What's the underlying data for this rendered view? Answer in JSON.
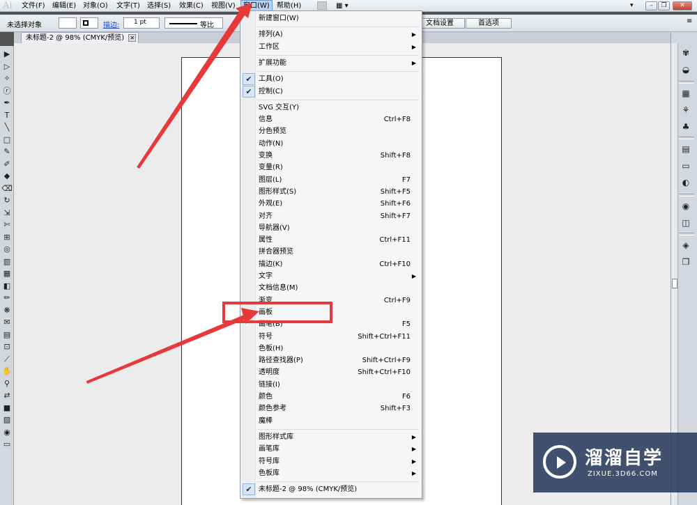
{
  "app": {
    "logo_text": "Ai"
  },
  "menubar": {
    "items": [
      "文件(F)",
      "编辑(E)",
      "对象(O)",
      "文字(T)",
      "选择(S)",
      "效果(C)",
      "视图(V)",
      "窗口(W)",
      "帮助(H)"
    ],
    "active_item": "窗口(W)",
    "layout_icon": "▦ ▾",
    "workspace_arrow": "▾",
    "window_buttons": {
      "minimize": "–",
      "restore": "❐",
      "close": "✕"
    }
  },
  "controlbar": {
    "selection_label": "未选择对象",
    "stroke_label": "描边:",
    "stroke_weight": "1 pt",
    "profile_label": "等比",
    "doc_setup_button": "文档设置",
    "preferences_button": "首选项",
    "right_icon": "≡"
  },
  "tab": {
    "title": "未标题-2 @ 98% (CMYK/预览)",
    "close": "✕"
  },
  "tools": [
    "▶",
    "▷",
    "✧",
    "ⓡ",
    "✒",
    "T",
    "╲",
    "□",
    "✎",
    "✐",
    "◆",
    "⌫",
    "↻",
    "⇲",
    "✄",
    "⊞",
    "◎",
    "▥",
    "▦",
    "◧",
    "✏",
    "❋",
    "✉",
    "▤",
    "⊡",
    "⟋",
    "✋",
    "⚲",
    "⇄",
    "■",
    "▨",
    "◉",
    "▭"
  ],
  "dock_icons": [
    "✾",
    "◒",
    "▦",
    "⚘",
    "♣",
    "▤",
    "▭",
    "◐",
    "◉",
    "◫",
    "◈",
    "❐"
  ],
  "window_menu": {
    "items": [
      {
        "label": "新建窗口(W)"
      },
      {
        "sep": true
      },
      {
        "label": "排列(A)",
        "submenu": true
      },
      {
        "label": "工作区",
        "submenu": true
      },
      {
        "sep": true
      },
      {
        "label": "扩展功能",
        "submenu": true
      },
      {
        "sep": true
      },
      {
        "label": "工具(O)",
        "checked": true
      },
      {
        "label": "控制(C)",
        "checked": true
      },
      {
        "sep": true
      },
      {
        "label": "SVG 交互(Y)"
      },
      {
        "label": "信息",
        "shortcut": "Ctrl+F8"
      },
      {
        "label": "分色预览"
      },
      {
        "label": "动作(N)"
      },
      {
        "label": "变换",
        "shortcut": "Shift+F8"
      },
      {
        "label": "变量(R)"
      },
      {
        "label": "图层(L)",
        "shortcut": "F7"
      },
      {
        "label": "图形样式(S)",
        "shortcut": "Shift+F5"
      },
      {
        "label": "外观(E)",
        "shortcut": "Shift+F6"
      },
      {
        "label": "对齐",
        "shortcut": "Shift+F7"
      },
      {
        "label": "导航器(V)"
      },
      {
        "label": "属性",
        "shortcut": "Ctrl+F11"
      },
      {
        "label": "拼合器预览"
      },
      {
        "label": "描边(K)",
        "shortcut": "Ctrl+F10"
      },
      {
        "label": "文字",
        "submenu": true
      },
      {
        "label": "文档信息(M)"
      },
      {
        "label": "渐变",
        "shortcut": "Ctrl+F9"
      },
      {
        "label": "画板"
      },
      {
        "label": "画笔(B)",
        "shortcut": "F5"
      },
      {
        "label": "符号",
        "shortcut": "Shift+Ctrl+F11"
      },
      {
        "label": "色板(H)"
      },
      {
        "label": "路径查找器(P)",
        "shortcut": "Shift+Ctrl+F9"
      },
      {
        "label": "透明度",
        "shortcut": "Shift+Ctrl+F10"
      },
      {
        "label": "链接(I)"
      },
      {
        "label": "颜色",
        "shortcut": "F6"
      },
      {
        "label": "颜色参考",
        "shortcut": "Shift+F3"
      },
      {
        "label": "魔棒"
      },
      {
        "sep": true
      },
      {
        "label": "图形样式库",
        "submenu": true
      },
      {
        "label": "画笔库",
        "submenu": true
      },
      {
        "label": "符号库",
        "submenu": true
      },
      {
        "label": "色板库",
        "submenu": true
      },
      {
        "sep": true
      },
      {
        "label": "未标题-2 @ 98% (CMYK/预览)",
        "checked": true
      }
    ]
  },
  "annotation": {
    "color": "#e8393a",
    "highlighted_item": "画板"
  },
  "watermark": {
    "title": "溜溜自学",
    "url": "ZIXUE.3D66.COM"
  }
}
